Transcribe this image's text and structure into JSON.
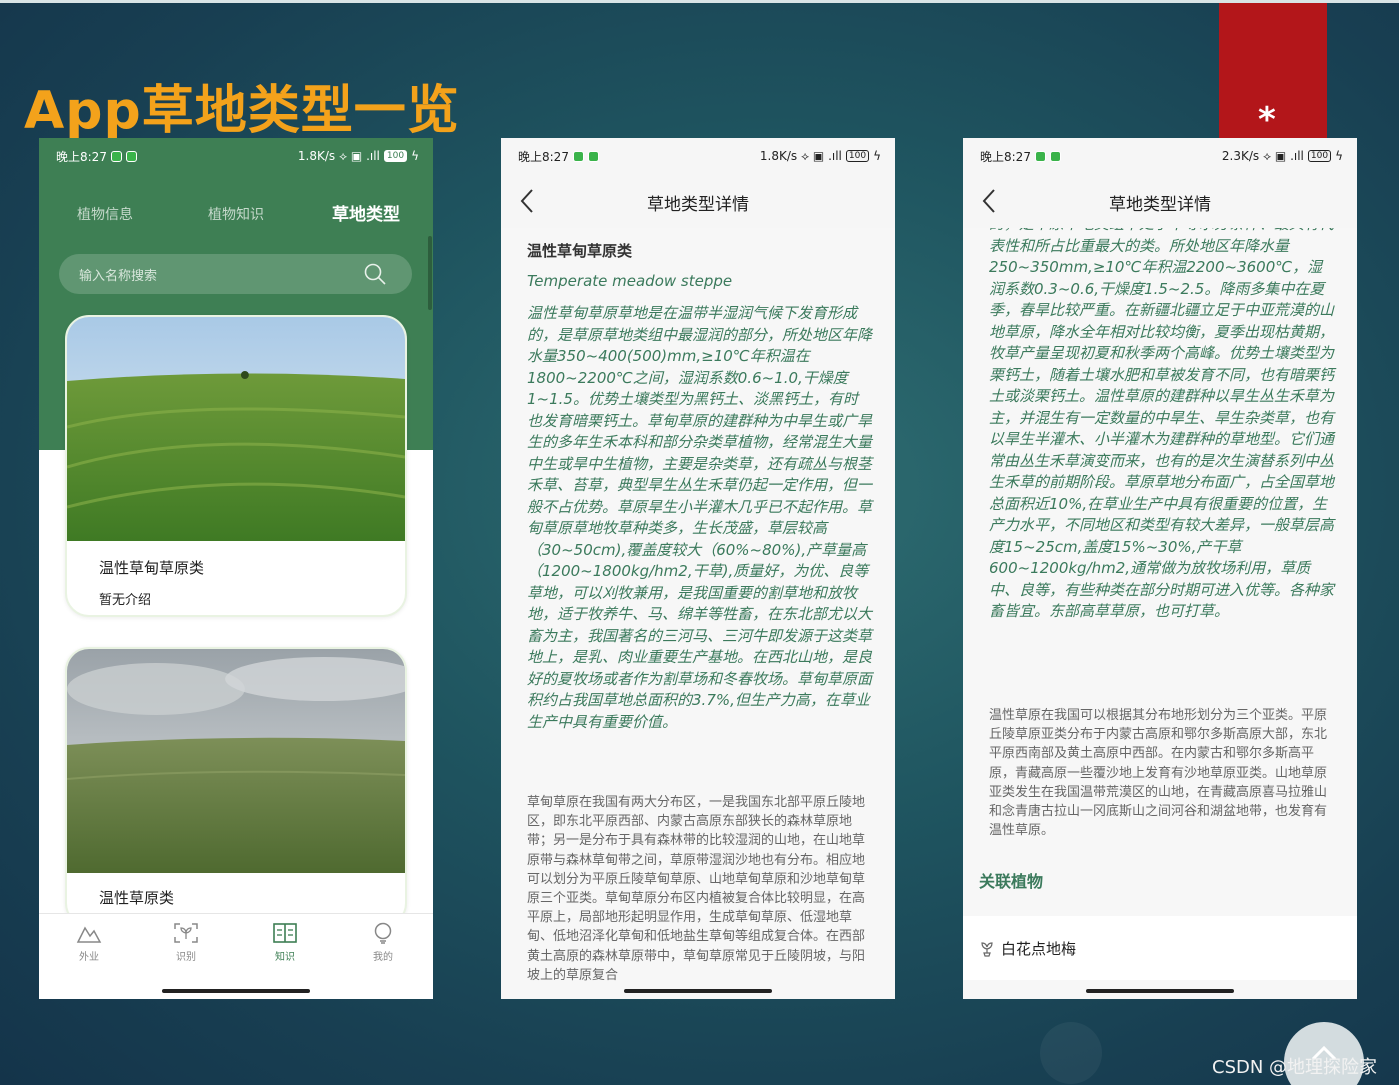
{
  "slide": {
    "title": "App草地类型一览",
    "asterisk": "*",
    "watermark": "CSDN @地理探险家"
  },
  "status_bar": {
    "time": "晚上8:27",
    "net_speed_1": "1.8K/s",
    "net_speed_3": "2.3K/s",
    "battery": "100"
  },
  "list_screen": {
    "tabs": [
      "植物信息",
      "植物知识",
      "草地类型"
    ],
    "search_placeholder": "输入名称搜索",
    "cards": [
      {
        "name": "温性草甸草原类",
        "desc": "暂无介绍"
      },
      {
        "name": "温性草原类"
      }
    ],
    "nav": [
      "外业",
      "识别",
      "知识",
      "我的"
    ]
  },
  "detail_screen_1": {
    "header": "草地类型详情",
    "title": "温性草甸草原类",
    "latin": "Temperate meadow steppe",
    "italic_text": "温性草甸草原草地是在温带半湿润气候下发育形成的，是草原草地类组中最湿润的部分，所处地区年降水量350~400(500)mm,≥10℃年积温在1800~2200℃之间，湿润系数0.6~1.0,干燥度1~1.5。优势土壤类型为黑钙土、淡黑钙土，有时也发育暗栗钙土。草甸草原的建群种为中旱生或广旱生的多年生禾本科和部分杂类草植物，经常混生大量中生或旱中生植物，主要是杂类草，还有疏丛与根茎禾草、苔草，典型旱生丛生禾草仍起一定作用，但一般不占优势。草原旱生小半灌木几乎已不起作用。草甸草原草地牧草种类多，生长茂盛，草层较高（30~50cm),覆盖度较大（60%~80%),产草量高（1200~1800kg/hm2,干草),质量好，为优、良等草地，可以刈牧兼用，是我国重要的割草地和放牧地，适于牧养牛、马、绵羊等牲畜，在东北部尤以大畜为主，我国著名的三河马、三河牛即发源于这类草地上，是乳、肉业重要生产基地。在西北山地，是良好的夏牧场或者作为割草场和冬春牧场。草甸草原面积约占我国草地总面积的3.7%,但生产力高，在草业生产中具有重要价值。",
    "plain_text": "草甸草原在我国有两大分布区，一是我国东北部平原丘陵地区，即东北平原西部、内蒙古高原东部狭长的森林草原地带；另一是分布于具有森林带的比较湿润的山地，在山地草原带与森林草甸带之间，草原带湿润沙地也有分布。相应地可以划分为平原丘陵草甸草原、山地草甸草原和沙地草甸草原三个亚类。草甸草原分布区内植被复合体比较明显，在高平原上，局部地形起明显作用，生成草甸草原、低湿地草甸、低地沼泽化草甸和低地盐生草甸等组成复合体。在西部黄土高原的森林草原带中，草甸草原常见于丘陵阴坡，与阳坡上的草原复合"
  },
  "detail_screen_2": {
    "header": "草地类型详情",
    "italic_text": "的，是草原草地类组中处于中等水分条件、最具有代表性和所占比重最大的类。所处地区年降水量250~350mm,≥10℃年积温2200~3600℃，湿润系数0.3~0.6,干燥度1.5~2.5。降雨多集中在夏季，春旱比较严重。在新疆北疆立足于中亚荒漠的山地草原，降水全年相对比较均衡，夏季出现枯黄期，牧草产量呈现初夏和秋季两个高峰。优势土壤类型为栗钙土，随着土壤水肥和草被发育不同，也有暗栗钙土或淡栗钙土。温性草原的建群种以旱生丛生禾草为主，并混生有一定数量的中旱生、旱生杂类草，也有以旱生半灌木、小半灌木为建群种的草地型。它们通常由丛生禾草演变而来，也有的是次生演替系列中丛生禾草的前期阶段。草原草地分布面广，占全国草地总面积近10%,在草业生产中具有很重要的位置，生产力水平，不同地区和类型有较大差异，一般草层高度15~25cm,盖度15%~30%,产干草600~1200kg/hm2,通常做为放牧场利用，草质中、良等，有些种类在部分时期可进入优等。各种家畜皆宜。东部高草草原，也可打草。",
    "plain_text": "温性草原在我国可以根据其分布地形划分为三个亚类。平原丘陵草原亚类分布于内蒙古高原和鄂尔多斯高原大部，东北平原西南部及黄土高原中西部。在内蒙古和鄂尔多斯高平原，青藏高原一些覆沙地上发育有沙地草原亚类。山地草原亚类发生在我国温带荒漠区的山地，在青藏高原喜马拉雅山和念青唐古拉山一冈底斯山之间河谷和湖盆地带，也发育有温性草原。",
    "related_title": "关联植物",
    "related_item": "白花点地梅"
  },
  "colors": {
    "title_orange": "#f3a21b",
    "app_green": "#3e7f54",
    "text_green": "#3b7a5c",
    "red_band": "#b3161a"
  }
}
